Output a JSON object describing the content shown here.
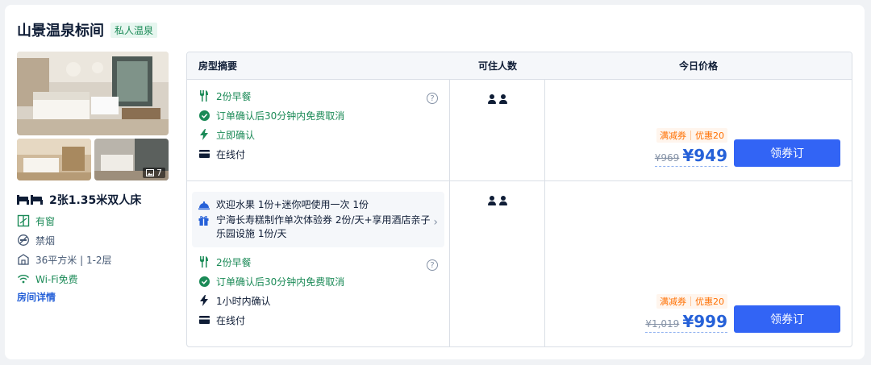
{
  "room": {
    "title": "山景温泉标间",
    "tag": "私人温泉",
    "photo_count": "7",
    "bed": "2张1.35米双人床",
    "facts": [
      {
        "icon": "window-icon",
        "text": "有窗",
        "color": "#1b8a57"
      },
      {
        "icon": "no-smoking-icon",
        "text": "禁烟",
        "color": "#455873"
      },
      {
        "icon": "area-icon",
        "text": "36平方米 | 1-2层",
        "color": "#455873"
      },
      {
        "icon": "wifi-icon",
        "text": "Wi-Fi免费",
        "color": "#1b8a57"
      }
    ],
    "detail_link": "房间详情"
  },
  "table": {
    "headers": {
      "summary": "房型摘要",
      "occupancy": "可住人数",
      "price": "今日价格"
    },
    "rows": [
      {
        "features": [
          {
            "icon": "breakfast-icon",
            "text": "2份早餐",
            "style": "green"
          },
          {
            "icon": "check-circle-icon",
            "text": "订单确认后30分钟内免费取消",
            "style": "green"
          },
          {
            "icon": "lightning-icon",
            "text": "立即确认",
            "style": "green"
          },
          {
            "icon": "card-icon",
            "text": "在线付",
            "style": "dark"
          }
        ],
        "help": "?",
        "coupon_label": "满减券",
        "coupon_discount": "优惠20",
        "old_price": "¥969",
        "new_price": "¥949",
        "button": "领券订"
      },
      {
        "perks": [
          {
            "icon": "cloche-icon",
            "text": "欢迎水果 1份+迷你吧使用一次 1份"
          },
          {
            "icon": "gift-icon",
            "text": "宁海长寿糕制作单次体验券 2份/天+享用酒店亲子乐园设施 1份/天"
          }
        ],
        "features": [
          {
            "icon": "breakfast-icon",
            "text": "2份早餐",
            "style": "green"
          },
          {
            "icon": "check-circle-icon",
            "text": "订单确认后30分钟内免费取消",
            "style": "green"
          },
          {
            "icon": "lightning-icon",
            "text": "1小时内确认",
            "style": "dark"
          },
          {
            "icon": "card-icon",
            "text": "在线付",
            "style": "dark"
          }
        ],
        "help": "?",
        "coupon_label": "满减券",
        "coupon_discount": "优惠20",
        "old_price": "¥1,019",
        "new_price": "¥999",
        "button": "领券订"
      }
    ]
  },
  "colors": {
    "accent": "#3264f5",
    "green": "#1b8a57",
    "price": "#2661d8",
    "coupon": "#ff6f00"
  }
}
